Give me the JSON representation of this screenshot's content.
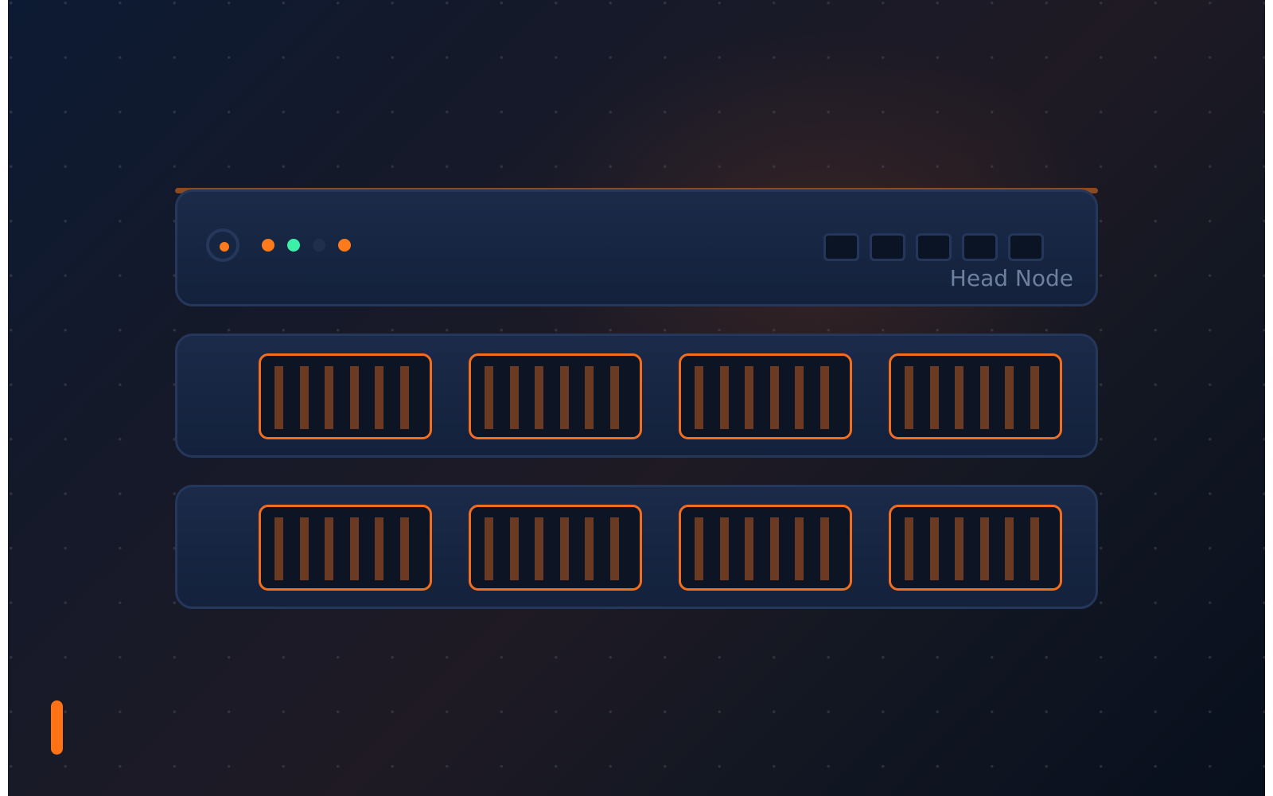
{
  "rack": {
    "head_node": {
      "label": "Head Node",
      "power_icon": "power-button-icon",
      "status_leds": [
        {
          "name": "status-led-1",
          "color": "#ff7a1a",
          "state": "on"
        },
        {
          "name": "status-led-2",
          "color": "#3cf0a8",
          "state": "on"
        },
        {
          "name": "status-led-3",
          "color": "#1f2f4c",
          "state": "off"
        },
        {
          "name": "status-led-4",
          "color": "#ff7a1a",
          "state": "on"
        }
      ],
      "port_count": 5
    },
    "compute_units": [
      {
        "name": "compute-unit-1",
        "bays": 4,
        "vents_per_bay": 6
      },
      {
        "name": "compute-unit-2",
        "bays": 4,
        "vents_per_bay": 6
      }
    ]
  },
  "colors": {
    "accent": "#ff7316",
    "accent_dim": "#6a3a22",
    "panel_border": "#25375a",
    "panel_fill": "#1a2a48",
    "led_green": "#3cf0a8",
    "label": "#6d809f"
  },
  "icons": [
    "power-button-icon",
    "side-indicator-icon"
  ]
}
